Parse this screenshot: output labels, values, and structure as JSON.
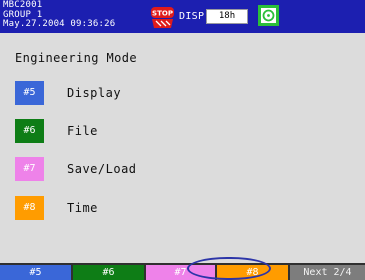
{
  "status_bar": {
    "device_id": "MBC2001",
    "group": "GROUP 1",
    "datetime": "May.27.2004 09:36:26",
    "stop_badge": "STOP",
    "disp_label": "DISP",
    "interval": "18h",
    "icons": {
      "stop": "stop-badge-icon",
      "media": "media-card-icon"
    },
    "colors": {
      "bar": "#1c1fb0",
      "stop": "#e01b1b",
      "media": "#2bbf3a"
    }
  },
  "main": {
    "title": "Engineering Mode",
    "menu": [
      {
        "key": "#5",
        "label": "Display",
        "color": "#3a67d8"
      },
      {
        "key": "#6",
        "label": "File",
        "color": "#0e7d16"
      },
      {
        "key": "#7",
        "label": "Save/Load",
        "color": "#ee82e9"
      },
      {
        "key": "#8",
        "label": "Time",
        "color": "#ff9c00"
      }
    ]
  },
  "softkeys": {
    "items": [
      {
        "label": "#5",
        "color": "#3a67d8"
      },
      {
        "label": "#6",
        "color": "#0e7d16"
      },
      {
        "label": "#7",
        "color": "#ee82e9"
      },
      {
        "label": "#8",
        "color": "#ff9c00"
      }
    ],
    "next_label": "Next 2/4"
  }
}
